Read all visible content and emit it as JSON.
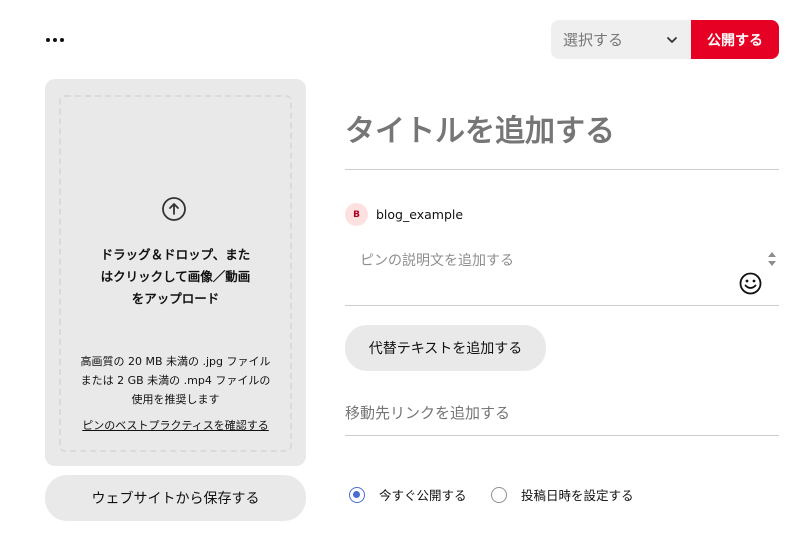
{
  "header": {
    "more_icon": "ellipsis-icon",
    "board_select": {
      "value": "選択する",
      "icon": "chevron-down-icon"
    },
    "publish_label": "公開する",
    "colors": {
      "publish": "#e60023",
      "select_bg": "#efefef"
    }
  },
  "upload": {
    "icon": "arrow-up-circle-icon",
    "main_lines": [
      "ドラッグ＆ドロップ、また",
      "はクリックして画像／動画",
      "をアップロード"
    ],
    "note_lines": [
      "高画質の 20 MB 未満の .jpg ファイル",
      "または 2 GB 未満の .mp4 ファイルの",
      "使用を推奨します"
    ],
    "best_practice_link": "ピンのベストプラクティスを確認する",
    "save_from_website_label": "ウェブサイトから保存する"
  },
  "form": {
    "title_placeholder": "タイトルを追加する",
    "user": {
      "avatar_letter": "B",
      "name": "blog_example"
    },
    "description_placeholder": "ピンの説明文を追加する",
    "alt_text_label": "代替テキストを追加する",
    "link_placeholder": "移動先リンクを追加する",
    "publish_options": [
      {
        "label": "今すぐ公開する",
        "checked": true
      },
      {
        "label": "投稿日時を設定する",
        "checked": false
      }
    ],
    "accent_color": "#4a6cd1"
  }
}
